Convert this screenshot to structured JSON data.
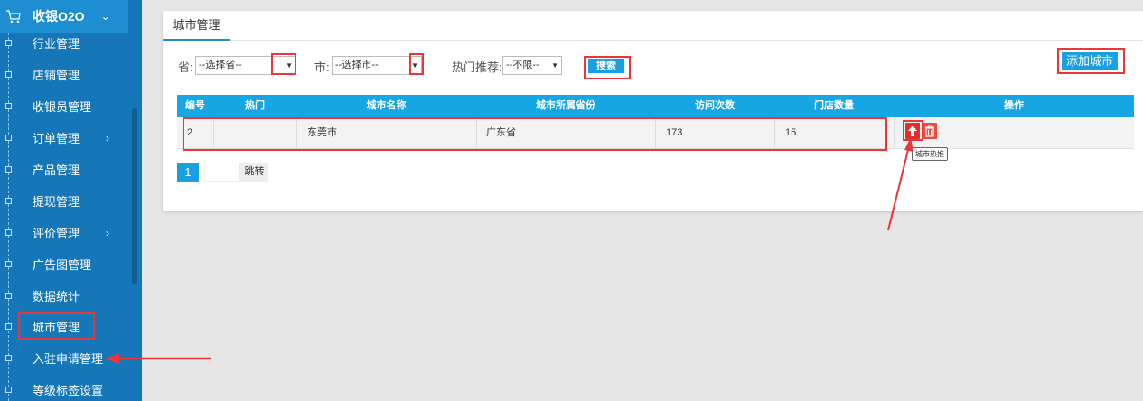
{
  "sidebar": {
    "header_title": "收银O2O",
    "items": [
      {
        "label": "行业管理",
        "arrow": ""
      },
      {
        "label": "店铺管理",
        "arrow": ""
      },
      {
        "label": "收银员管理",
        "arrow": ""
      },
      {
        "label": "订单管理",
        "arrow": "›"
      },
      {
        "label": "产品管理",
        "arrow": ""
      },
      {
        "label": "提现管理",
        "arrow": ""
      },
      {
        "label": "评价管理",
        "arrow": "›"
      },
      {
        "label": "广告图管理",
        "arrow": ""
      },
      {
        "label": "数据统计",
        "arrow": ""
      },
      {
        "label": "城市管理",
        "arrow": ""
      },
      {
        "label": "入驻申请管理",
        "arrow": ""
      },
      {
        "label": "等级标签设置",
        "arrow": ""
      }
    ]
  },
  "tab": {
    "label": "城市管理"
  },
  "filters": {
    "province_label": "省:",
    "province_value": "--选择省--",
    "city_label": "市:",
    "city_value": "--选择市--",
    "hot_label": "热门推荐:",
    "hot_value": "--不限--",
    "search_label": "搜索"
  },
  "add_city_label": "添加城市",
  "table": {
    "headers": [
      "编号",
      "热门",
      "城市名称",
      "城市所属省份",
      "访问次数",
      "门店数量",
      "操作"
    ],
    "row": {
      "id": "2",
      "hot": "",
      "city": "东莞市",
      "province": "广东省",
      "visits": "173",
      "stores": "15"
    }
  },
  "tooltip": "城市热推",
  "pager": {
    "current": "1",
    "go_label": "跳转"
  },
  "colors": {
    "accent": "#1a9fe0",
    "sidebar": "#1577b7",
    "highlight": "#e8363b"
  }
}
